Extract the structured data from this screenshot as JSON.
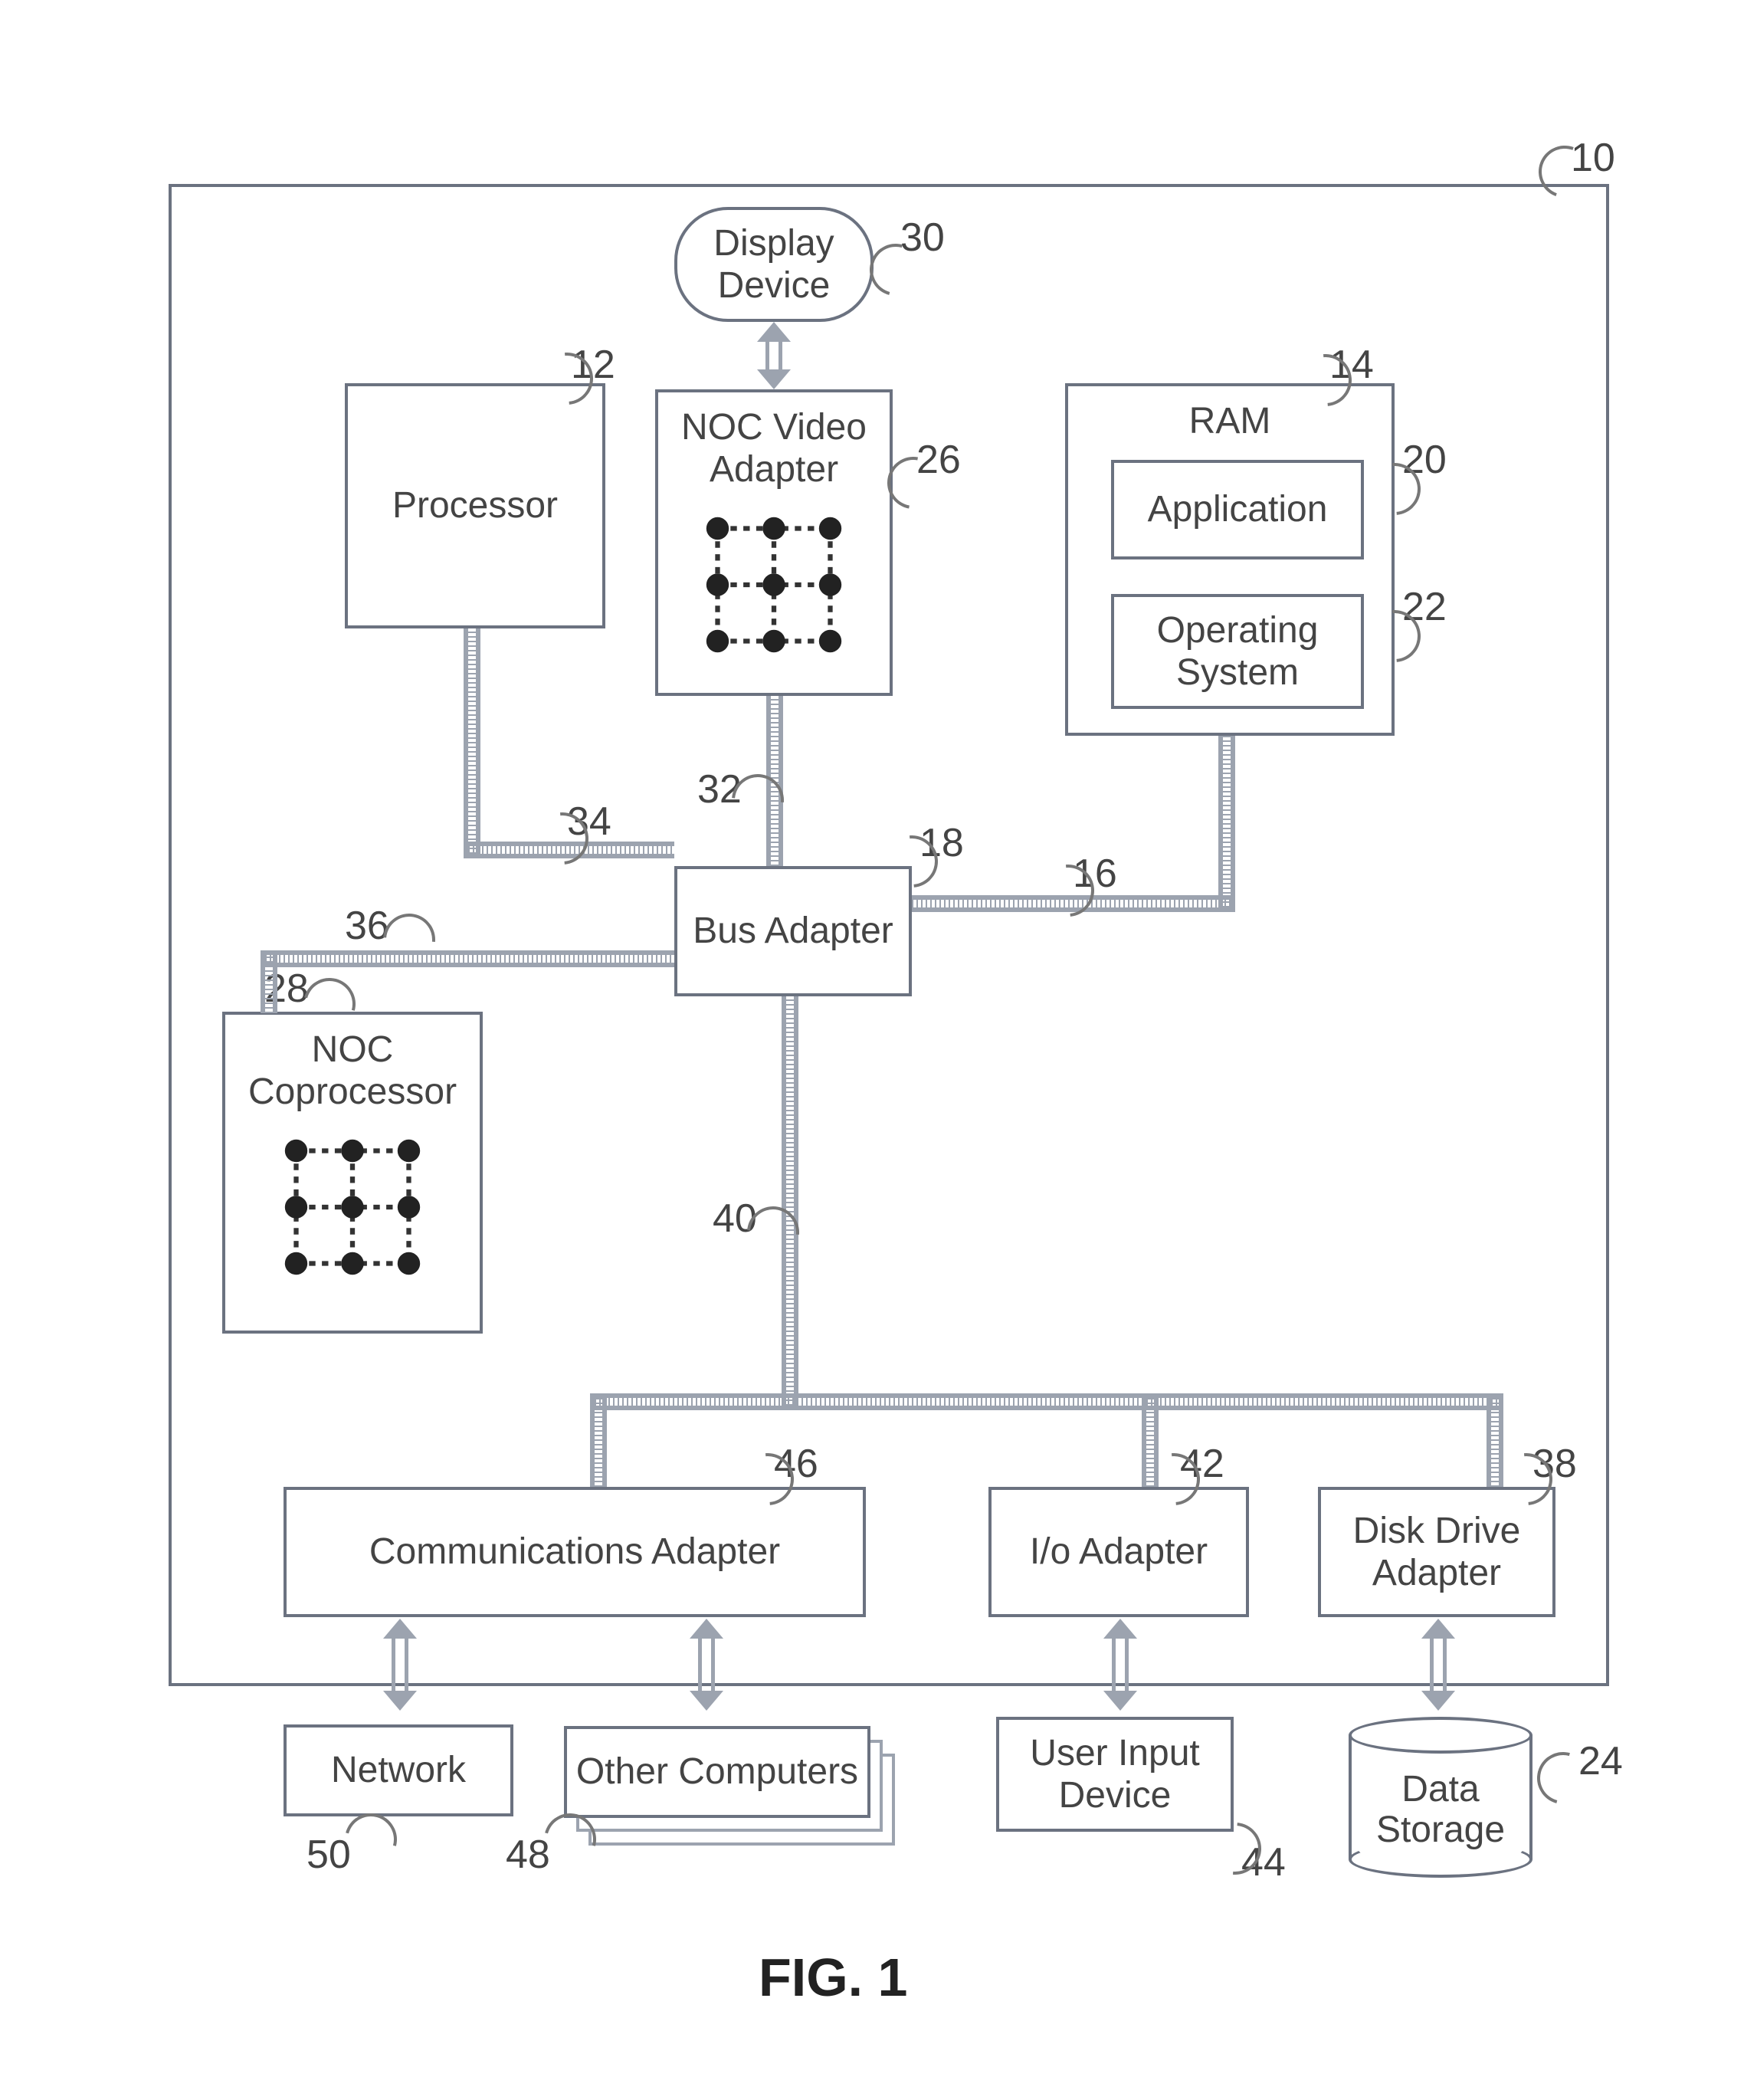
{
  "figure_caption": "FIG. 1",
  "outer_ref": "10",
  "blocks": {
    "display": {
      "label": "Display\nDevice",
      "ref": "30"
    },
    "processor": {
      "label": "Processor",
      "ref": "12"
    },
    "noc_video": {
      "label": "NOC Video\nAdapter",
      "ref": "26"
    },
    "ram": {
      "label": "RAM",
      "ref": "14"
    },
    "application": {
      "label": "Application",
      "ref": "20"
    },
    "os": {
      "label": "Operating\nSystem",
      "ref": "22"
    },
    "bus_adapter": {
      "label": "Bus Adapter",
      "ref": "18"
    },
    "noc_coproc": {
      "label": "NOC\nCoprocessor",
      "ref": "28"
    },
    "comms": {
      "label": "Communications Adapter",
      "ref": "46"
    },
    "io_adapter": {
      "label": "I/o Adapter",
      "ref": "42"
    },
    "disk_adapter": {
      "label": "Disk Drive\nAdapter",
      "ref": "38"
    },
    "network": {
      "label": "Network",
      "ref": "50"
    },
    "other_pcs": {
      "label": "Other Computers",
      "ref": "48"
    },
    "user_input": {
      "label": "User Input\nDevice",
      "ref": "44"
    },
    "data_storage": {
      "label": "Data\nStorage",
      "ref": "24"
    }
  },
  "buses": {
    "proc_to_bus": {
      "ref": "34"
    },
    "video_to_bus": {
      "ref": "32"
    },
    "ram_to_bus": {
      "ref": "16"
    },
    "coproc_to_bus": {
      "ref": "36"
    },
    "expansion": {
      "ref": "40"
    }
  }
}
